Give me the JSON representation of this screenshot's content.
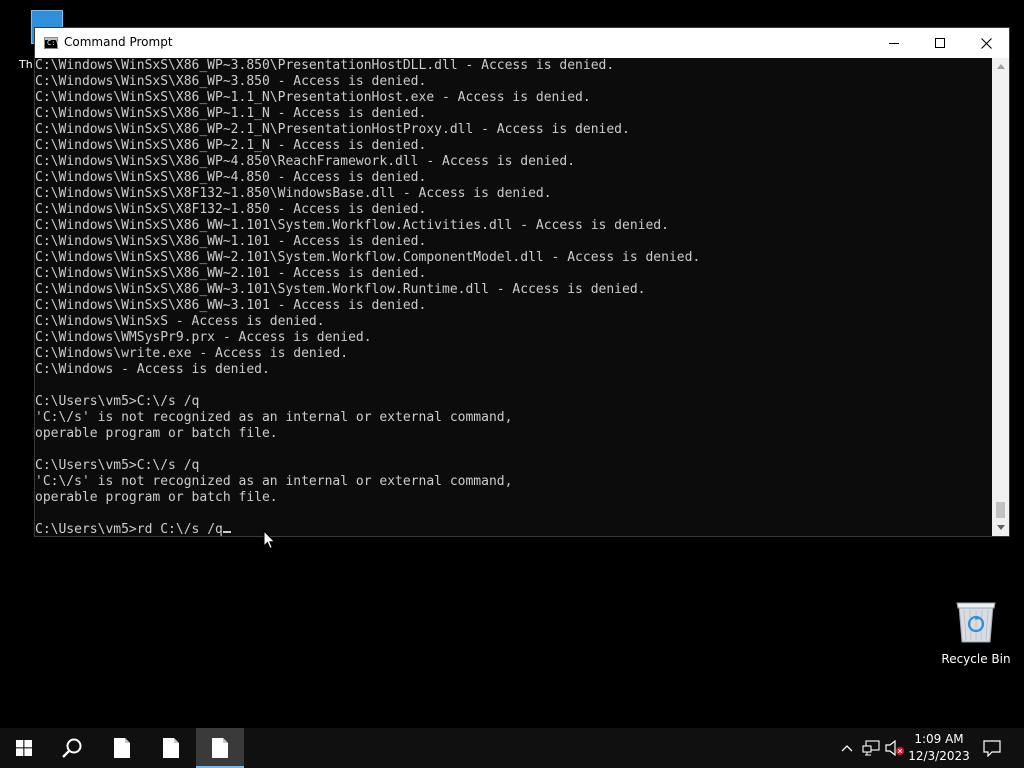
{
  "desktop": {
    "partial_icon_label": "Th",
    "recycle_bin_label": "Recycle Bin"
  },
  "window": {
    "title": "Command Prompt",
    "icon_text": "C:\\"
  },
  "console": {
    "lines": [
      "C:\\Windows\\WinSxS\\X86_WP~3.850\\PresentationHostDLL.dll - Access is denied.",
      "C:\\Windows\\WinSxS\\X86_WP~3.850 - Access is denied.",
      "C:\\Windows\\WinSxS\\X86_WP~1.1_N\\PresentationHost.exe - Access is denied.",
      "C:\\Windows\\WinSxS\\X86_WP~1.1_N - Access is denied.",
      "C:\\Windows\\WinSxS\\X86_WP~2.1_N\\PresentationHostProxy.dll - Access is denied.",
      "C:\\Windows\\WinSxS\\X86_WP~2.1_N - Access is denied.",
      "C:\\Windows\\WinSxS\\X86_WP~4.850\\ReachFramework.dll - Access is denied.",
      "C:\\Windows\\WinSxS\\X86_WP~4.850 - Access is denied.",
      "C:\\Windows\\WinSxS\\X8F132~1.850\\WindowsBase.dll - Access is denied.",
      "C:\\Windows\\WinSxS\\X8F132~1.850 - Access is denied.",
      "C:\\Windows\\WinSxS\\X86_WW~1.101\\System.Workflow.Activities.dll - Access is denied.",
      "C:\\Windows\\WinSxS\\X86_WW~1.101 - Access is denied.",
      "C:\\Windows\\WinSxS\\X86_WW~2.101\\System.Workflow.ComponentModel.dll - Access is denied.",
      "C:\\Windows\\WinSxS\\X86_WW~2.101 - Access is denied.",
      "C:\\Windows\\WinSxS\\X86_WW~3.101\\System.Workflow.Runtime.dll - Access is denied.",
      "C:\\Windows\\WinSxS\\X86_WW~3.101 - Access is denied.",
      "C:\\Windows\\WinSxS - Access is denied.",
      "C:\\Windows\\WMSysPr9.prx - Access is denied.",
      "C:\\Windows\\write.exe - Access is denied.",
      "C:\\Windows - Access is denied.",
      "",
      "C:\\Users\\vm5>C:\\/s /q",
      "'C:\\/s' is not recognized as an internal or external command,",
      "operable program or batch file.",
      "",
      "C:\\Users\\vm5>C:\\/s /q",
      "'C:\\/s' is not recognized as an internal or external command,",
      "operable program or batch file.",
      ""
    ],
    "prompt": "C:\\Users\\vm5>",
    "current_input": "rd C:\\/s /q"
  },
  "taskbar": {
    "time": "1:09 AM",
    "date": "12/3/2023"
  },
  "colors": {
    "console_bg": "#0c0c0c",
    "console_text": "#cccccc",
    "taskbar_bg": "#101010",
    "accent": "#76b9ed"
  },
  "icons": {
    "start": "windows-logo-icon",
    "search": "search-icon",
    "file": "file-icon",
    "tray_chevron": "chevron-up-icon",
    "network": "network-icon",
    "volume": "volume-muted-icon",
    "notifications": "notification-icon"
  }
}
